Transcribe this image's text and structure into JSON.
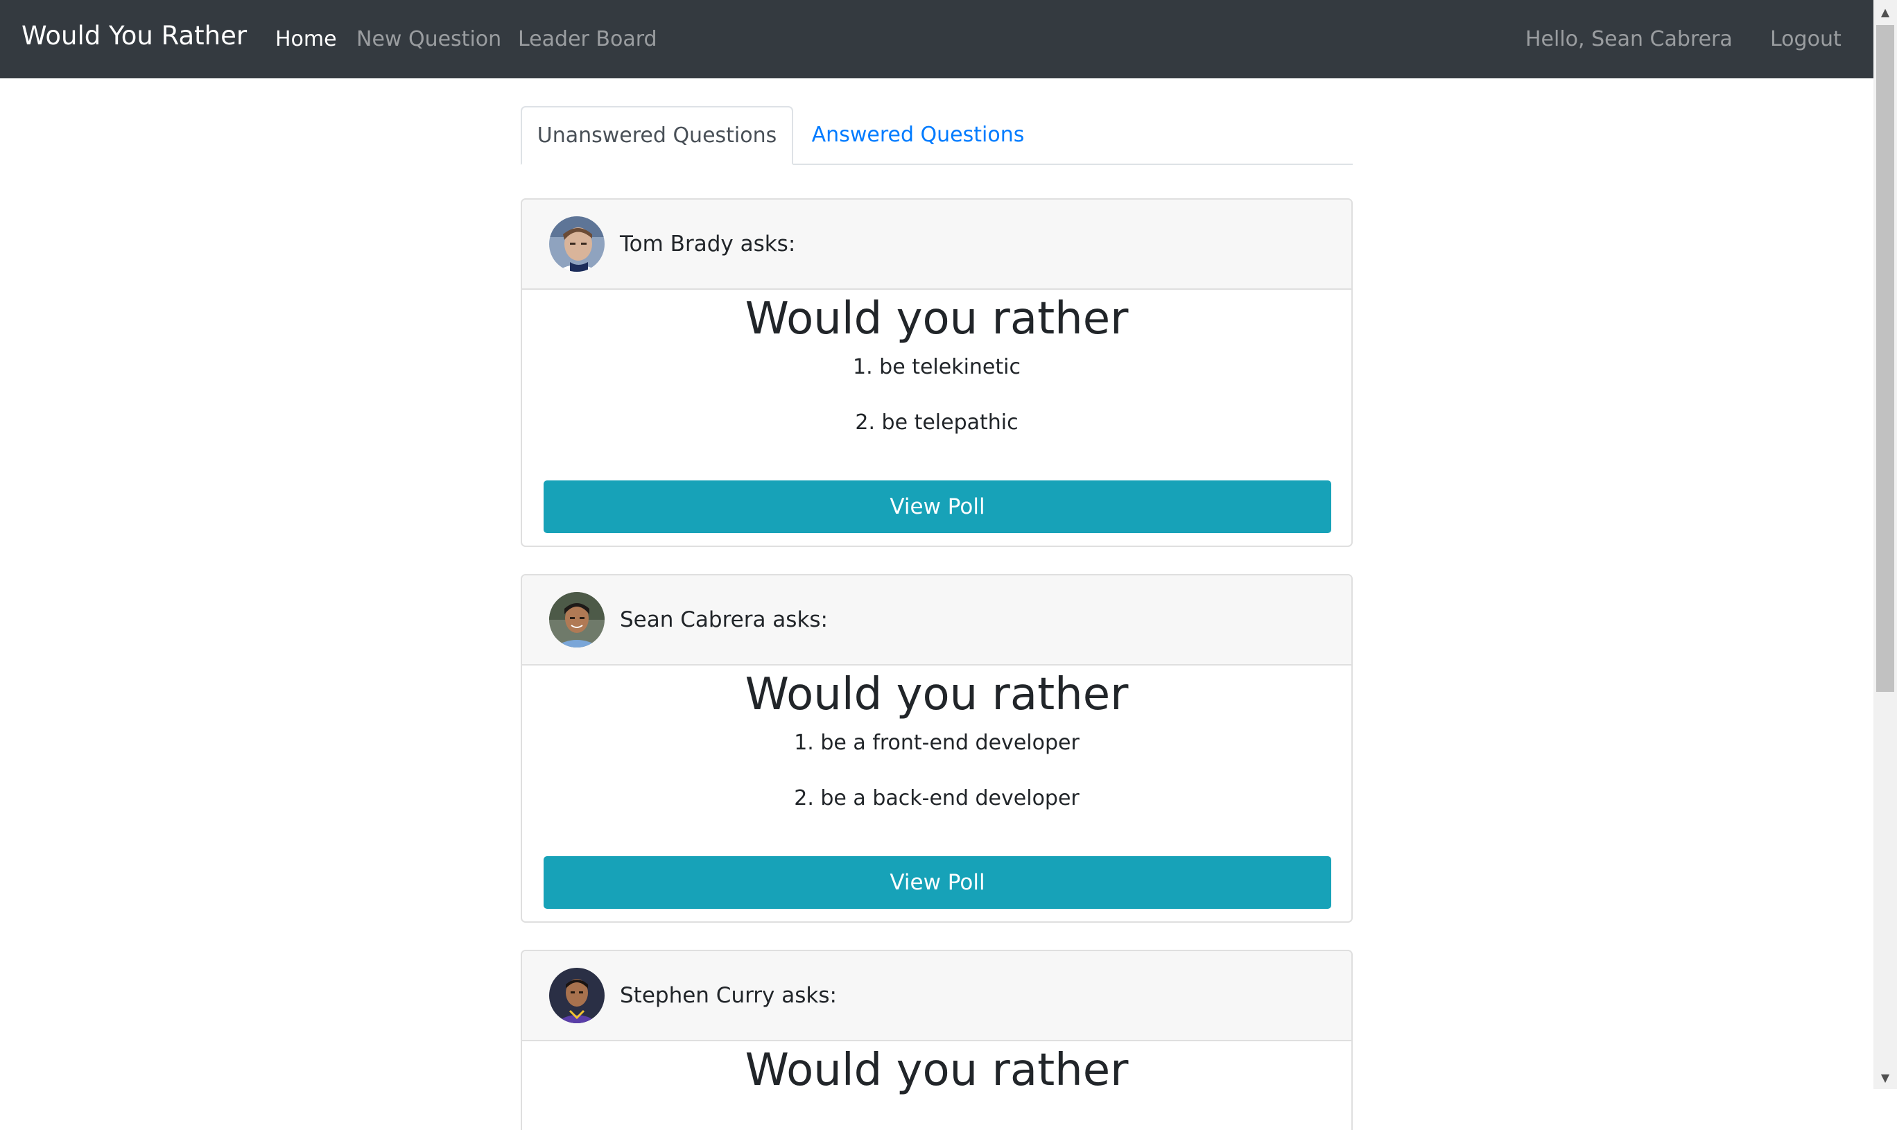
{
  "navbar": {
    "brand": "Would You Rather",
    "links": [
      "Home",
      "New Question",
      "Leader Board"
    ],
    "active_link": "Home",
    "greeting": "Hello, Sean Cabrera",
    "logout": "Logout"
  },
  "tabs": {
    "unanswered": "Unanswered Questions",
    "answered": "Answered Questions",
    "active": "Unanswered Questions"
  },
  "questions": [
    {
      "asks": "Tom Brady asks:",
      "title": "Would you rather",
      "option_one": "1. be telekinetic",
      "option_two": "2. be telepathic",
      "button": "View Poll"
    },
    {
      "asks": "Sean Cabrera asks:",
      "title": "Would you rather",
      "option_one": "1. be a front-end developer",
      "option_two": "2. be a back-end developer",
      "button": "View Poll"
    },
    {
      "asks": "Stephen Curry asks:",
      "title": "Would you rather",
      "option_one": "",
      "option_two": "",
      "button": ""
    }
  ],
  "colors": {
    "navbar_bg": "#343a40",
    "button_bg": "#17a2b8",
    "link_blue": "#007bff"
  }
}
